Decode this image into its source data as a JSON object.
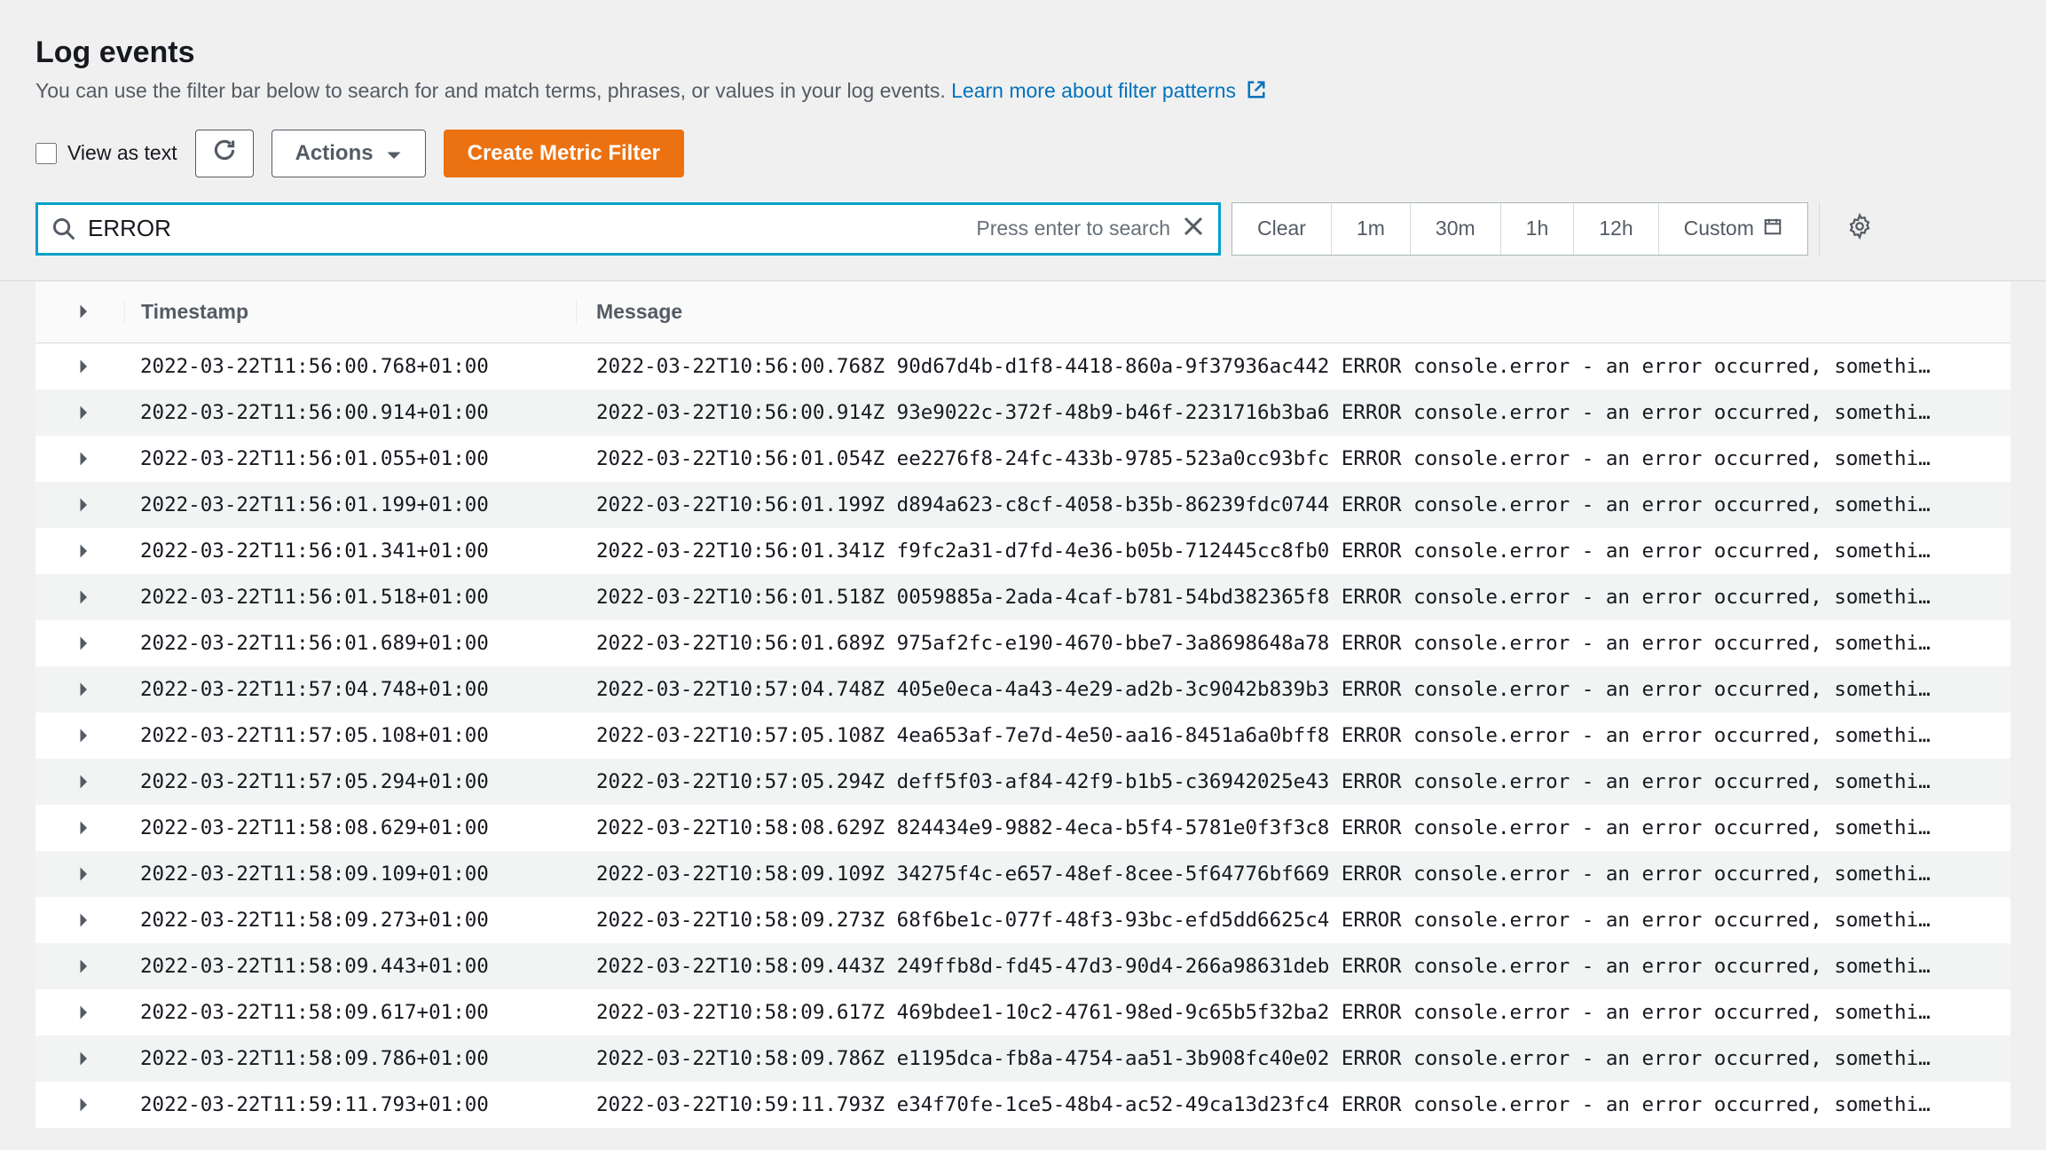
{
  "header": {
    "title": "Log events",
    "subtitle_prefix": "You can use the filter bar below to search for and match terms, phrases, or values in your log events. ",
    "learn_more_label": "Learn more about filter patterns"
  },
  "toolbar": {
    "view_as_text_label": "View as text",
    "actions_label": "Actions",
    "create_metric_filter_label": "Create Metric Filter"
  },
  "search": {
    "value": "ERROR",
    "hint": "Press enter to search"
  },
  "time_range": {
    "items": [
      "Clear",
      "1m",
      "30m",
      "1h",
      "12h"
    ],
    "custom_label": "Custom"
  },
  "table": {
    "headers": {
      "timestamp": "Timestamp",
      "message": "Message"
    },
    "rows": [
      {
        "timestamp": "2022-03-22T11:56:00.768+01:00",
        "message": "2022-03-22T10:56:00.768Z 90d67d4b-d1f8-4418-860a-9f37936ac442 ERROR console.error - an error occurred, somethi…"
      },
      {
        "timestamp": "2022-03-22T11:56:00.914+01:00",
        "message": "2022-03-22T10:56:00.914Z 93e9022c-372f-48b9-b46f-2231716b3ba6 ERROR console.error - an error occurred, somethi…"
      },
      {
        "timestamp": "2022-03-22T11:56:01.055+01:00",
        "message": "2022-03-22T10:56:01.054Z ee2276f8-24fc-433b-9785-523a0cc93bfc ERROR console.error - an error occurred, somethi…"
      },
      {
        "timestamp": "2022-03-22T11:56:01.199+01:00",
        "message": "2022-03-22T10:56:01.199Z d894a623-c8cf-4058-b35b-86239fdc0744 ERROR console.error - an error occurred, somethi…"
      },
      {
        "timestamp": "2022-03-22T11:56:01.341+01:00",
        "message": "2022-03-22T10:56:01.341Z f9fc2a31-d7fd-4e36-b05b-712445cc8fb0 ERROR console.error - an error occurred, somethi…"
      },
      {
        "timestamp": "2022-03-22T11:56:01.518+01:00",
        "message": "2022-03-22T10:56:01.518Z 0059885a-2ada-4caf-b781-54bd382365f8 ERROR console.error - an error occurred, somethi…"
      },
      {
        "timestamp": "2022-03-22T11:56:01.689+01:00",
        "message": "2022-03-22T10:56:01.689Z 975af2fc-e190-4670-bbe7-3a8698648a78 ERROR console.error - an error occurred, somethi…"
      },
      {
        "timestamp": "2022-03-22T11:57:04.748+01:00",
        "message": "2022-03-22T10:57:04.748Z 405e0eca-4a43-4e29-ad2b-3c9042b839b3 ERROR console.error - an error occurred, somethi…"
      },
      {
        "timestamp": "2022-03-22T11:57:05.108+01:00",
        "message": "2022-03-22T10:57:05.108Z 4ea653af-7e7d-4e50-aa16-8451a6a0bff8 ERROR console.error - an error occurred, somethi…"
      },
      {
        "timestamp": "2022-03-22T11:57:05.294+01:00",
        "message": "2022-03-22T10:57:05.294Z deff5f03-af84-42f9-b1b5-c36942025e43 ERROR console.error - an error occurred, somethi…"
      },
      {
        "timestamp": "2022-03-22T11:58:08.629+01:00",
        "message": "2022-03-22T10:58:08.629Z 824434e9-9882-4eca-b5f4-5781e0f3f3c8 ERROR console.error - an error occurred, somethi…"
      },
      {
        "timestamp": "2022-03-22T11:58:09.109+01:00",
        "message": "2022-03-22T10:58:09.109Z 34275f4c-e657-48ef-8cee-5f64776bf669 ERROR console.error - an error occurred, somethi…"
      },
      {
        "timestamp": "2022-03-22T11:58:09.273+01:00",
        "message": "2022-03-22T10:58:09.273Z 68f6be1c-077f-48f3-93bc-efd5dd6625c4 ERROR console.error - an error occurred, somethi…"
      },
      {
        "timestamp": "2022-03-22T11:58:09.443+01:00",
        "message": "2022-03-22T10:58:09.443Z 249ffb8d-fd45-47d3-90d4-266a98631deb ERROR console.error - an error occurred, somethi…"
      },
      {
        "timestamp": "2022-03-22T11:58:09.617+01:00",
        "message": "2022-03-22T10:58:09.617Z 469bdee1-10c2-4761-98ed-9c65b5f32ba2 ERROR console.error - an error occurred, somethi…"
      },
      {
        "timestamp": "2022-03-22T11:58:09.786+01:00",
        "message": "2022-03-22T10:58:09.786Z e1195dca-fb8a-4754-aa51-3b908fc40e02 ERROR console.error - an error occurred, somethi…"
      },
      {
        "timestamp": "2022-03-22T11:59:11.793+01:00",
        "message": "2022-03-22T10:59:11.793Z e34f70fe-1ce5-48b4-ac52-49ca13d23fc4 ERROR console.error - an error occurred, somethi…"
      }
    ]
  }
}
